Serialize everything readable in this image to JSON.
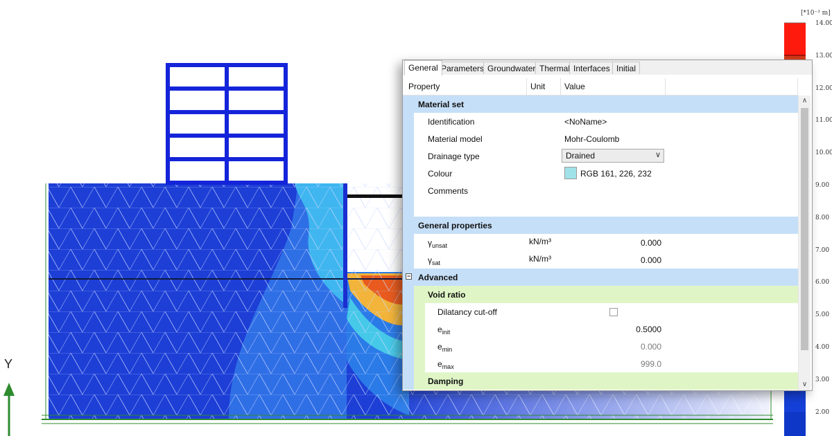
{
  "legend": {
    "unit": "[*10⁻³ m]",
    "values": [
      "14.00",
      "13.00",
      "12.00",
      "11.00",
      "10.00",
      "9.00",
      "8.00",
      "7.00",
      "6.00",
      "5.00",
      "4.00",
      "3.00",
      "2.00"
    ]
  },
  "axis": {
    "y_label": "Y"
  },
  "dialog": {
    "tabs": [
      "General",
      "Parameters",
      "Groundwater",
      "Thermal",
      "Interfaces",
      "Initial"
    ],
    "columns": {
      "property": "Property",
      "unit": "Unit",
      "value": "Value"
    },
    "material_set": {
      "title": "Material set",
      "identification": {
        "label": "Identification",
        "value": "<NoName>"
      },
      "material_model": {
        "label": "Material model",
        "value": "Mohr-Coulomb"
      },
      "drainage_type": {
        "label": "Drainage type",
        "value": "Drained"
      },
      "colour": {
        "label": "Colour",
        "value": "RGB 161, 226, 232",
        "swatch": "#a1e2e8"
      },
      "comments": {
        "label": "Comments"
      }
    },
    "general_properties": {
      "title": "General properties",
      "gamma_unsat": {
        "symbol": "γ",
        "sub": "unsat",
        "unit": "kN/m³",
        "value": "0.000"
      },
      "gamma_sat": {
        "symbol": "γ",
        "sub": "sat",
        "unit": "kN/m³",
        "value": "0.000"
      }
    },
    "advanced": {
      "title": "Advanced",
      "collapse_glyph": "−",
      "void_ratio": {
        "title": "Void ratio",
        "dilatancy_cutoff": {
          "label": "Dilatancy cut-off",
          "checked": false
        },
        "e_init": {
          "symbol": "e",
          "sub": "init",
          "value": "0.5000"
        },
        "e_min": {
          "symbol": "e",
          "sub": "min",
          "value": "0.000"
        },
        "e_max": {
          "symbol": "e",
          "sub": "max",
          "value": "999.0"
        }
      },
      "damping": {
        "title": "Damping"
      }
    }
  }
}
